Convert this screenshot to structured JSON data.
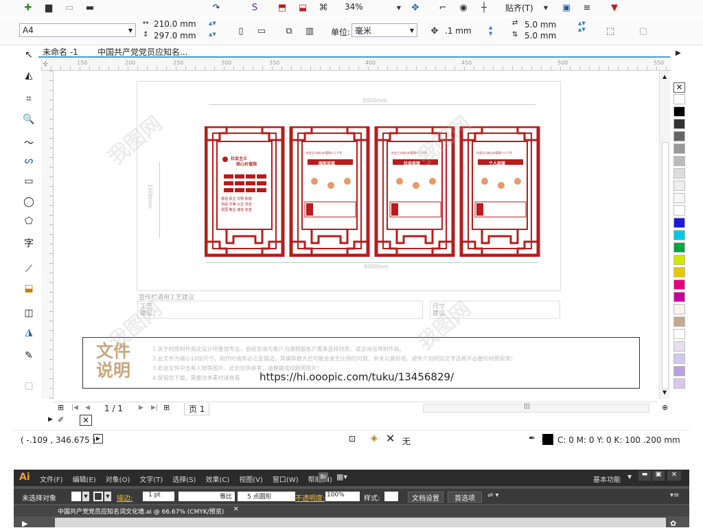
{
  "toolbar1": {
    "zoom": "34%",
    "snap_label": "贴齐(T)"
  },
  "toolbar2": {
    "page_size": "A4",
    "width": "210.0 mm",
    "height": "297.0 mm",
    "units_label": "单位:",
    "units_value": "毫米",
    "nudge": ".1 mm",
    "dup_x": "5.0 mm",
    "dup_y": "5.0 mm"
  },
  "tabs": [
    "未命名 -1",
    "中国共产党党员应知名..."
  ],
  "ruler": {
    "h_ticks": [
      "150",
      "200",
      "250",
      "300",
      "350",
      "400",
      "450",
      "500",
      "550"
    ]
  },
  "drawing": {
    "dim_top": "5000mm",
    "dim_bottom": "8000mm",
    "dim_left": "1500mm",
    "section_title": "宣传栏通用工艺建议",
    "craft_label": "工艺建议",
    "size_label": "尺寸建议",
    "board1_title": "社会主义",
    "board1_heading": "核心价值观",
    "board1_lines": [
      "富强 民主 文明 和谐",
      "自由 平等 公正 法治",
      "爱国 敬业 诚信 友善"
    ],
    "board2_title": "国家层面",
    "board3_title": "社会层面",
    "board4_title": "个人层面",
    "board_heading": "社会主义核心价值观十二个字",
    "doc_heading": "文件说明",
    "doc_lines": [
      "1.关于材质制作商北设计师要加专业，会给您请与客户沟通相服各户需来选择材质，或咨询当地制作商。",
      "2.此文件为缩小10倍尺寸，制作时请务必注意描边，其编等放大后可能会发生比例的问题，并关以直校视，避免个别明别文字选框不必要的材质现束！",
      "3.若迷文件中含有人物等图片，此处仅供参考，请替换成印刷用图片！",
      "4.保留您下载，需要改本素材请直看"
    ],
    "url": "https://hi.ooopic.com/tuku/13456829/"
  },
  "page_nav": {
    "current": "1 / 1",
    "page_tab": "页 1"
  },
  "status": {
    "coords": "( -.109 , 346.675 )",
    "fill": "无",
    "outline": "C: 0 M: 0 Y: 0 K: 100  .200 mm"
  },
  "ai": {
    "logo": "Ai",
    "menu": [
      "文件(F)",
      "编辑(E)",
      "对象(O)",
      "文字(T)",
      "选择(S)",
      "效果(C)",
      "视图(V)",
      "窗口(W)",
      "帮助(H)"
    ],
    "workspace": "基本功能",
    "no_selection": "未选择对象",
    "stroke_label": "描边:",
    "stroke_value": "1 pt",
    "line_style": "等比",
    "brush": "5 点圆形",
    "opacity_label": "不透明度:",
    "opacity_value": "100%",
    "style_label": "样式:",
    "doc_settings": "文档设置",
    "prefs": "首选项",
    "doc_tab": "中国共产党党员应知名词文化墙.ai @ 66.67% (CMYK/预览)"
  },
  "palette": [
    "#ffffff",
    "#000000",
    "#333333",
    "#666666",
    "#999999",
    "#bbbbbb",
    "#dddddd",
    "#eeeeee",
    "#f5f5f5",
    "#ffffff",
    "#1a1adc",
    "#00c8e6",
    "#00a63c",
    "#d2e600",
    "#e6c800",
    "#e6007e",
    "#c8009a",
    "#fff0f0",
    "#c8a88c",
    "#ffffff",
    "#e8e0f0",
    "#d0c8f0",
    "#b8a0e0",
    "#d8c8f0"
  ]
}
